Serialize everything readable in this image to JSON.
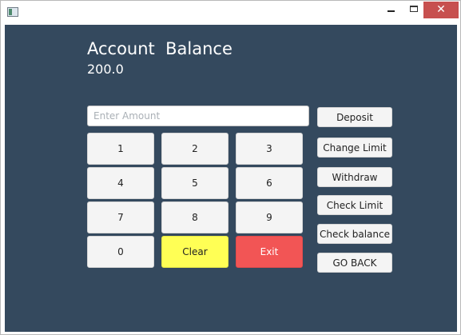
{
  "window": {
    "close_glyph": "✕"
  },
  "header": {
    "title": "Account  Balance",
    "balance": "200.0"
  },
  "amount": {
    "placeholder": "Enter Amount",
    "value": ""
  },
  "keypad": {
    "k1": "1",
    "k2": "2",
    "k3": "3",
    "k4": "4",
    "k5": "5",
    "k6": "6",
    "k7": "7",
    "k8": "8",
    "k9": "9",
    "k0": "0",
    "clear": "Clear",
    "exit": "Exit"
  },
  "actions": {
    "deposit": "Deposit",
    "change_limit": "Change Limit",
    "withdraw": "Withdraw",
    "check_limit": "Check Limit",
    "check_balance": "Check balance",
    "go_back": "GO BACK"
  },
  "colors": {
    "background": "#34495e",
    "clear": "#ffff55",
    "exit": "#f25555",
    "close": "#c7504f"
  }
}
